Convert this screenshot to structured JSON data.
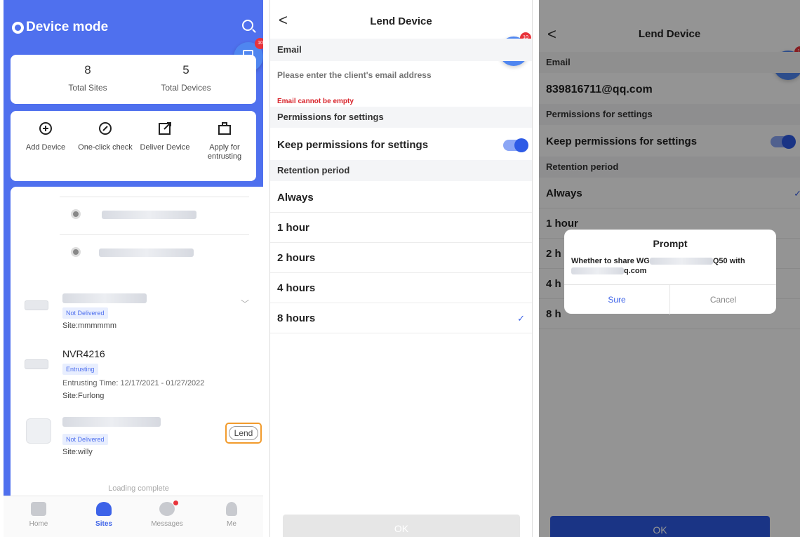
{
  "panel1": {
    "header_title": "Device mode",
    "fab_badge": "10",
    "stats": [
      {
        "value": "8",
        "label": "Total Sites"
      },
      {
        "value": "5",
        "label": "Total Devices"
      }
    ],
    "quick_actions": [
      {
        "label": "Add Device",
        "icon": "add-device-icon"
      },
      {
        "label": "One-click check",
        "icon": "one-click-check-icon"
      },
      {
        "label": "Deliver Device",
        "icon": "deliver-device-icon"
      },
      {
        "label": "Apply for entrusting",
        "icon": "apply-entrusting-icon"
      }
    ],
    "devices": [
      {
        "name": "",
        "status": "Not Delivered",
        "site": "Site:mmmmmm"
      },
      {
        "name": "NVR4216",
        "status": "Entrusting",
        "time": "Entrusting Time: 12/17/2021 - 01/27/2022",
        "site": "Site:Furlong"
      },
      {
        "name": "",
        "status": "Not Delivered",
        "site": "Site:willy"
      }
    ],
    "lend_label": "Lend",
    "loading_text": "Loading complete",
    "tabs": [
      {
        "label": "Home"
      },
      {
        "label": "Sites"
      },
      {
        "label": "Messages"
      },
      {
        "label": "Me"
      }
    ]
  },
  "panel2": {
    "title": "Lend Device",
    "email_section": "Email",
    "email_placeholder": "Please enter the client's email address",
    "email_error": "Email cannot be empty",
    "permissions_section": "Permissions for settings",
    "keep_permissions": "Keep permissions for settings",
    "retention_section": "Retention period",
    "options": [
      "Always",
      "1 hour",
      "2 hours",
      "4 hours",
      "8 hours"
    ],
    "selected_option": "8 hours",
    "ok_label": "OK",
    "fab_badge": "10"
  },
  "panel3": {
    "title": "Lend Device",
    "email_section": "Email",
    "email_value": "839816711@qq.com",
    "permissions_section": "Permissions for settings",
    "keep_permissions": "Keep permissions for settings",
    "retention_section": "Retention period",
    "options": [
      "Always",
      "1 hour",
      "2 h",
      "4 h",
      "8 h"
    ],
    "ok_label": "OK",
    "fab_badge": "10",
    "dialog": {
      "title": "Prompt",
      "message_line1_start": "Whether to share WG",
      "message_line1_end": "Q50 with",
      "message_line2_end": "q.com",
      "sure_label": "Sure",
      "cancel_label": "Cancel"
    }
  },
  "colors": {
    "primary": "#4f70ee",
    "accent": "#3d63e8",
    "error": "#d8232a",
    "highlight": "#f29b2c"
  }
}
